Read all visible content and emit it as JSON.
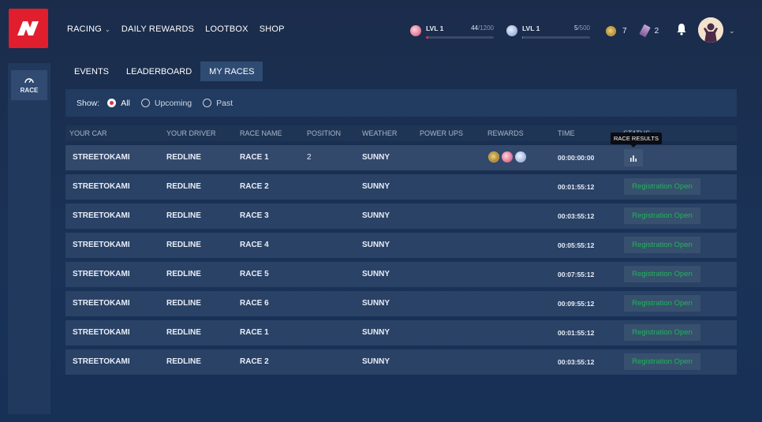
{
  "nav": {
    "items": [
      {
        "label": "RACING",
        "caret": "⌄"
      },
      {
        "label": "DAILY REWARDS"
      },
      {
        "label": "LOOTBOX"
      },
      {
        "label": "SHOP"
      }
    ]
  },
  "stats": {
    "level_a": {
      "name": "LVL 1",
      "current": "44",
      "max": "/1200",
      "progress": 0.037,
      "icon": "red-gem-icon"
    },
    "level_b": {
      "name": "LVL 1",
      "current": "5",
      "max": "/500",
      "progress": 0.01,
      "icon": "blue-gem-icon"
    },
    "coins": "7",
    "tickets": "2"
  },
  "sidebar": {
    "items": [
      {
        "label": "RACE",
        "icon": "speedometer-icon"
      }
    ]
  },
  "tabs": [
    {
      "label": "EVENTS",
      "active": false
    },
    {
      "label": "LEADERBOARD",
      "active": false
    },
    {
      "label": "MY RACES",
      "active": true
    }
  ],
  "filter": {
    "show_label": "Show:",
    "options": [
      {
        "label": "All",
        "checked": true
      },
      {
        "label": "Upcoming",
        "checked": false
      },
      {
        "label": "Past",
        "checked": false
      }
    ]
  },
  "table": {
    "headers": [
      "YOUR CAR",
      "YOUR DRIVER",
      "RACE NAME",
      "POSITION",
      "WEATHER",
      "POWER UPS",
      "REWARDS",
      "TIME",
      "STATUS"
    ],
    "rows": [
      {
        "car": "STREETOKAMI",
        "driver": "REDLINE",
        "race": "RACE 1",
        "position": "2",
        "weather": "SUNNY",
        "time": "00:00:00:00",
        "status": ""
      },
      {
        "car": "STREETOKAMI",
        "driver": "REDLINE",
        "race": "RACE 2",
        "position": "",
        "weather": "SUNNY",
        "time": "00:01:55:12",
        "status": "Registration Open"
      },
      {
        "car": "STREETOKAMI",
        "driver": "REDLINE",
        "race": "RACE 3",
        "position": "",
        "weather": "SUNNY",
        "time": "00:03:55:12",
        "status": "Registration Open"
      },
      {
        "car": "STREETOKAMI",
        "driver": "REDLINE",
        "race": "RACE 4",
        "position": "",
        "weather": "SUNNY",
        "time": "00:05:55:12",
        "status": "Registration Open"
      },
      {
        "car": "STREETOKAMI",
        "driver": "REDLINE",
        "race": "RACE 5",
        "position": "",
        "weather": "SUNNY",
        "time": "00:07:55:12",
        "status": "Registration Open"
      },
      {
        "car": "STREETOKAMI",
        "driver": "REDLINE",
        "race": "RACE 6",
        "position": "",
        "weather": "SUNNY",
        "time": "00:09:55:12",
        "status": "Registration Open"
      },
      {
        "car": "STREETOKAMI",
        "driver": "REDLINE",
        "race": "RACE 1",
        "position": "",
        "weather": "SUNNY",
        "time": "00:01:55:12",
        "status": "Registration Open"
      },
      {
        "car": "STREETOKAMI",
        "driver": "REDLINE",
        "race": "RACE 2",
        "position": "",
        "weather": "SUNNY",
        "time": "00:03:55:12",
        "status": "Registration Open"
      }
    ]
  },
  "tooltip": {
    "text": "RACE RESULTS"
  },
  "colors": {
    "accent": "#e01e2e",
    "registration": "#1fb55a"
  }
}
